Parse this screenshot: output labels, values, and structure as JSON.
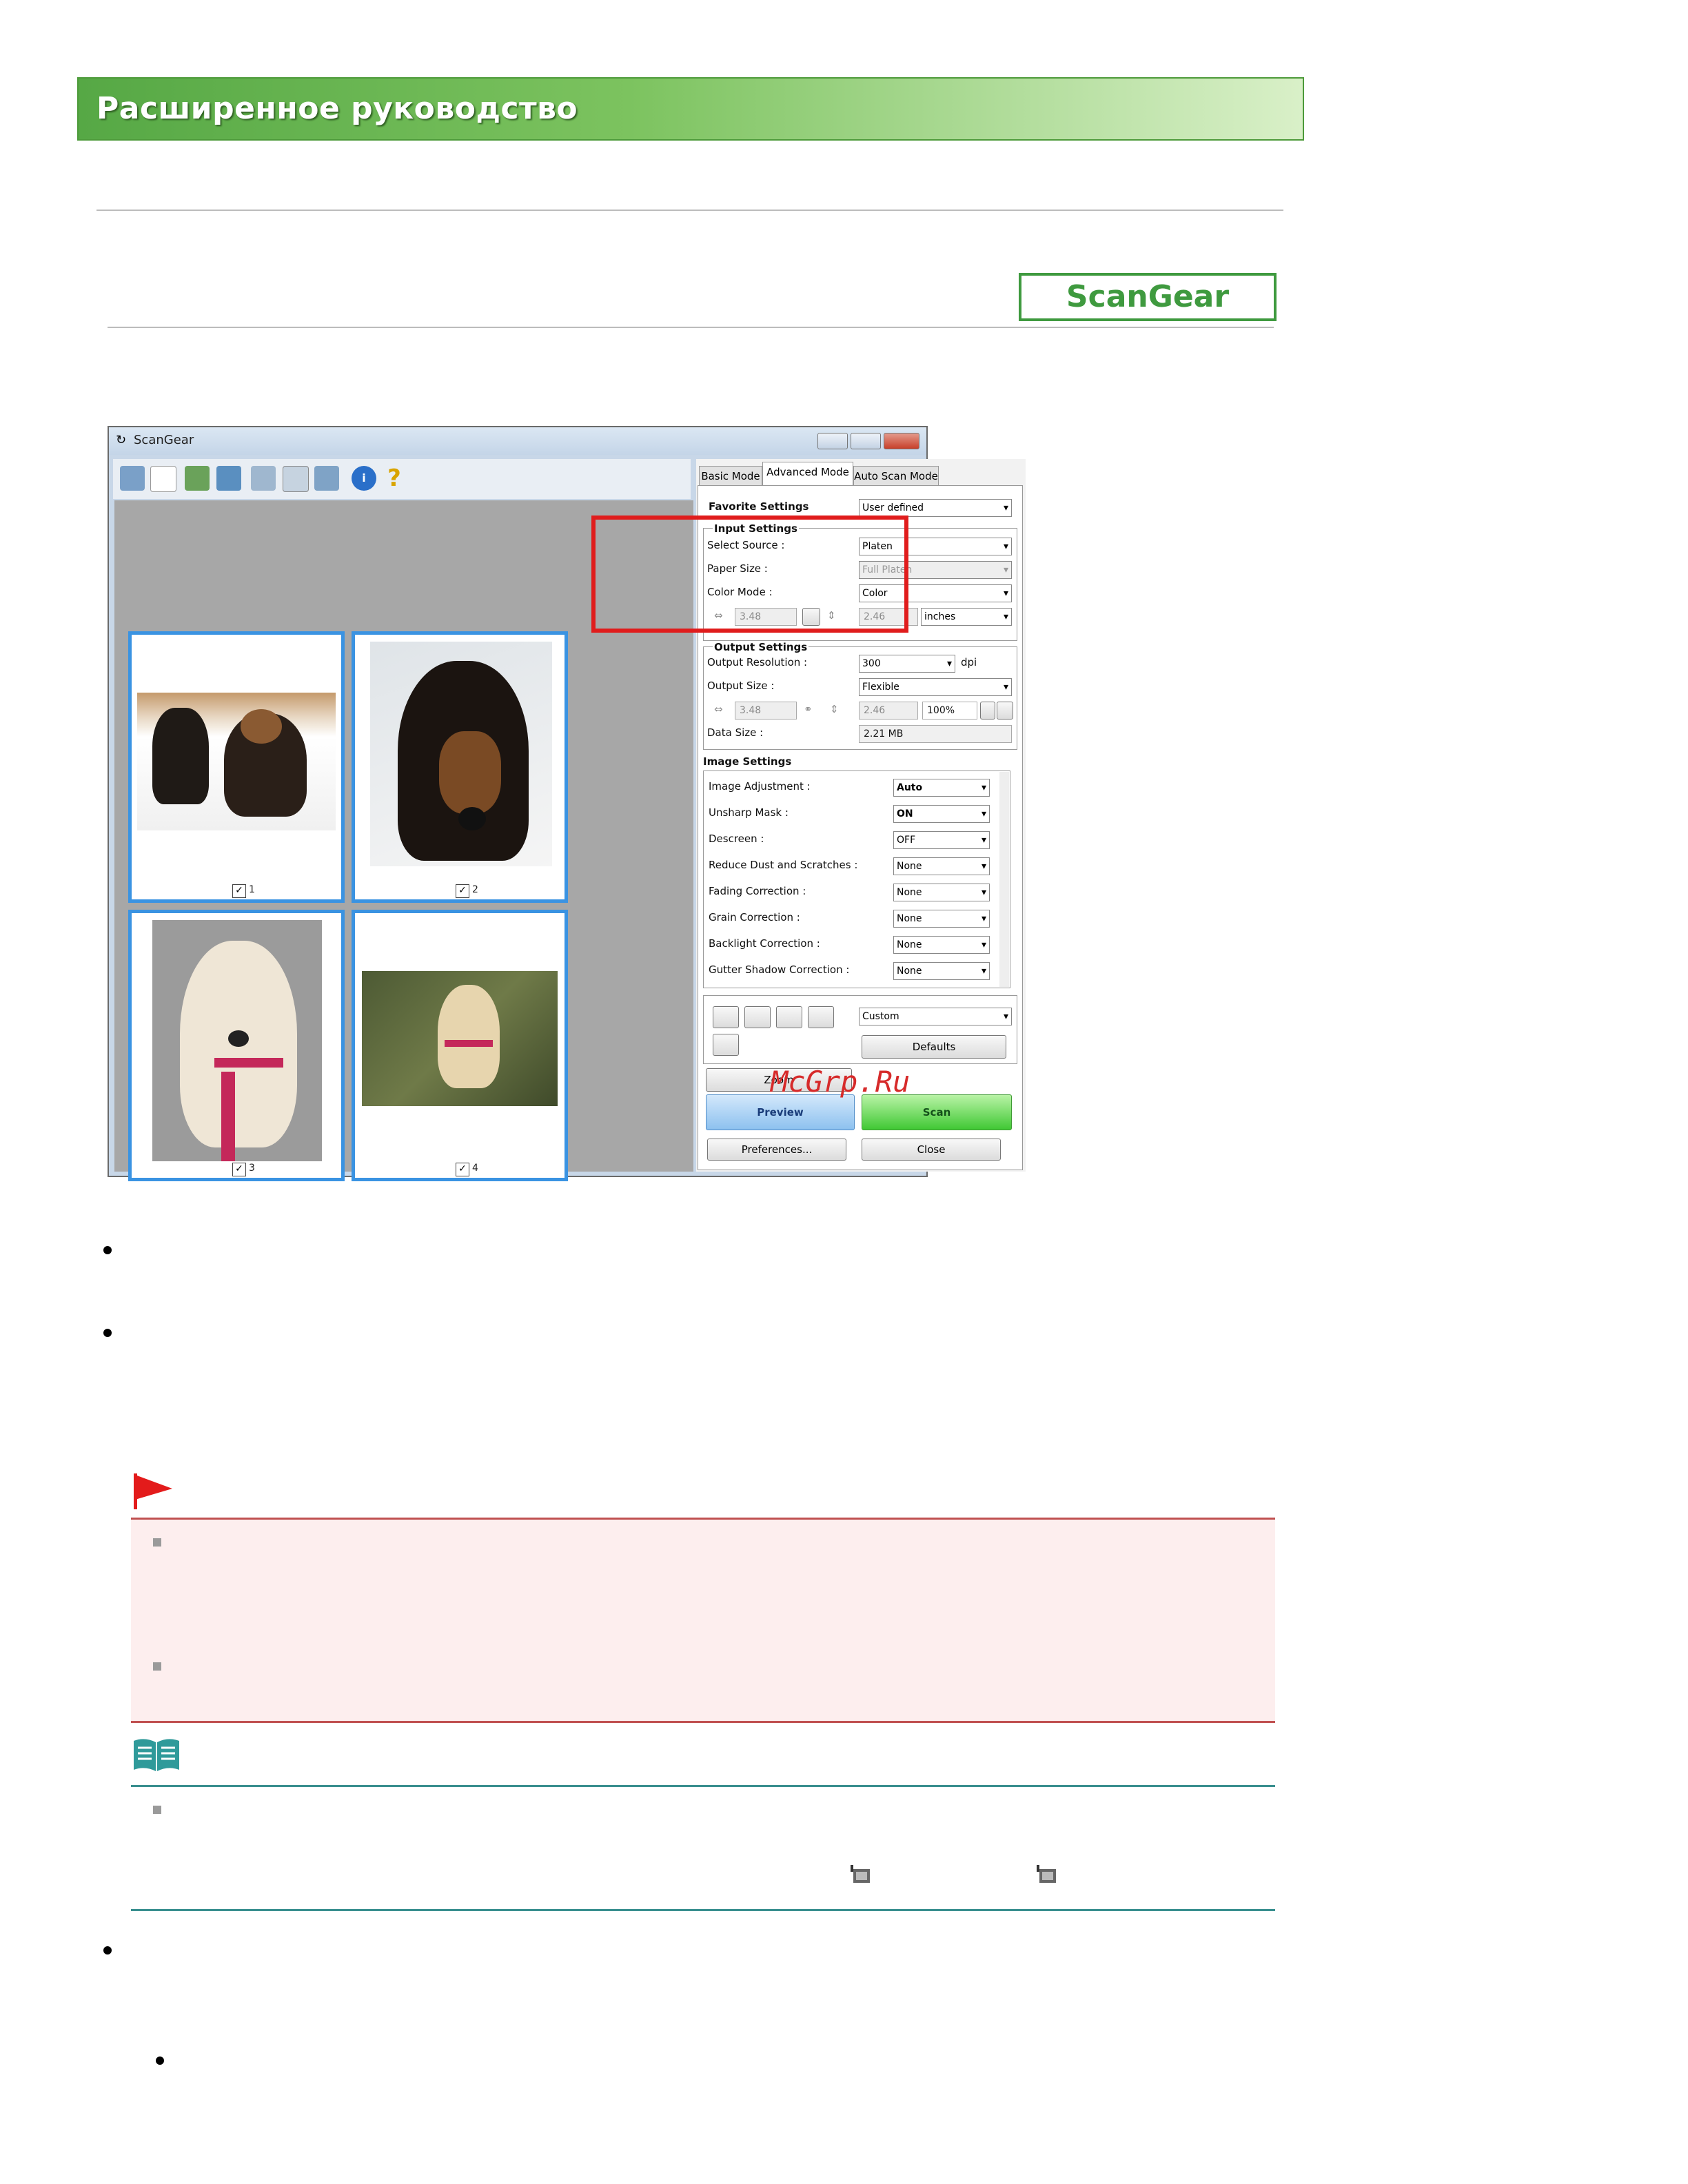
{
  "header": {
    "title": "Расширенное руководство"
  },
  "badge": {
    "label": "ScanGear"
  },
  "window": {
    "title": "ScanGear",
    "tabs": [
      "Basic Mode",
      "Advanced Mode",
      "Auto Scan Mode"
    ],
    "favorite": {
      "label": "Favorite Settings",
      "value": "User defined"
    },
    "input_settings": {
      "heading": "Input Settings",
      "select_source": {
        "label": "Select Source :",
        "value": "Platen"
      },
      "paper_size": {
        "label": "Paper Size :",
        "value": "Full Platen"
      },
      "color_mode": {
        "label": "Color Mode :",
        "value": "Color"
      },
      "width": "3.48",
      "height": "2.46",
      "units": "inches"
    },
    "output_settings": {
      "heading": "Output Settings",
      "resolution": {
        "label": "Output Resolution :",
        "value": "300",
        "unit": "dpi"
      },
      "size": {
        "label": "Output Size :",
        "value": "Flexible"
      },
      "width": "3.48",
      "height": "2.46",
      "scale": "100%",
      "data_size": {
        "label": "Data Size :",
        "value": "2.21 MB"
      }
    },
    "image_settings": {
      "heading": "Image Settings",
      "rows": [
        {
          "label": "Image Adjustment :",
          "value": "Auto"
        },
        {
          "label": "Unsharp Mask :",
          "value": "ON"
        },
        {
          "label": "Descreen :",
          "value": "OFF"
        },
        {
          "label": "Reduce Dust and Scratches :",
          "value": "None"
        },
        {
          "label": "Fading Correction :",
          "value": "None"
        },
        {
          "label": "Grain Correction :",
          "value": "None"
        },
        {
          "label": "Backlight Correction :",
          "value": "None"
        },
        {
          "label": "Gutter Shadow Correction :",
          "value": "None"
        }
      ]
    },
    "color_preset": "Custom",
    "defaults_label": "Defaults",
    "zoom_label": "Zoom",
    "preview_label": "Preview",
    "scan_label": "Scan",
    "preferences_label": "Preferences...",
    "close_label": "Close",
    "thumbs": [
      "1",
      "2",
      "3",
      "4"
    ]
  },
  "watermark": "McGrp.Ru",
  "colors": {
    "banner": "#56a845",
    "highlight": "#e01c1c",
    "caution_bg": "#fdeeee",
    "note_line": "#3a8f8f"
  }
}
